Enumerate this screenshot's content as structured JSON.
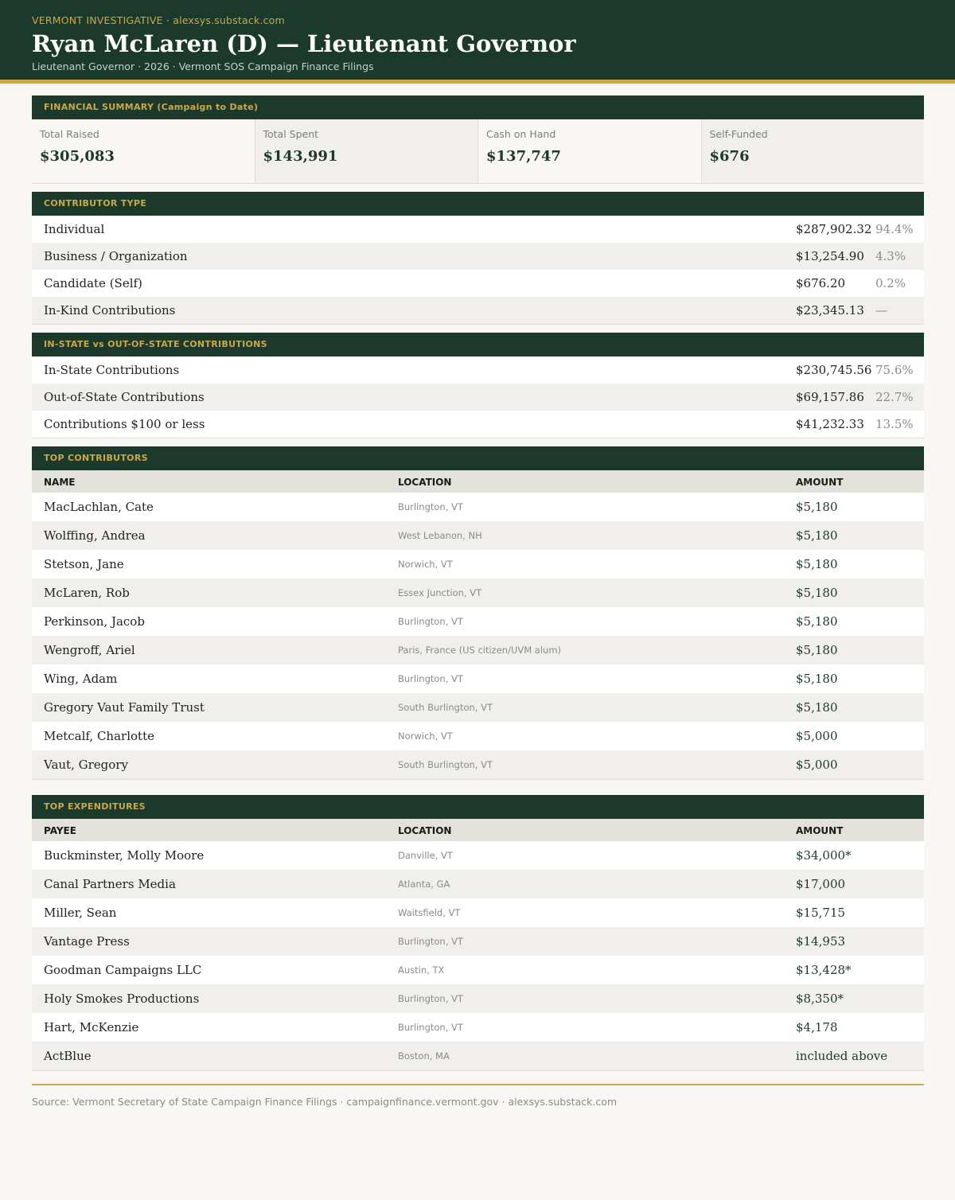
{
  "header": {
    "kicker": "VERMONT INVESTIGATIVE · alexsys.substack.com",
    "title": "Ryan McLaren (D) — Lieutenant Governor",
    "subtitle": "Lieutenant Governor · 2026 · Vermont SOS Campaign Finance Filings"
  },
  "summary": {
    "heading": "FINANCIAL SUMMARY (Campaign to Date)",
    "cells": [
      {
        "label": "Total Raised",
        "value": "$305,083"
      },
      {
        "label": "Total Spent",
        "value": "$143,991"
      },
      {
        "label": "Cash on Hand",
        "value": "$137,747"
      },
      {
        "label": "Self-Funded",
        "value": "$676"
      }
    ]
  },
  "contributor_type": {
    "heading": "CONTRIBUTOR TYPE",
    "rows": [
      {
        "label": "Individual",
        "amount": "$287,902.32",
        "pct": "94.4%"
      },
      {
        "label": "Business / Organization",
        "amount": "$13,254.90",
        "pct": "4.3%"
      },
      {
        "label": "Candidate (Self)",
        "amount": "$676.20",
        "pct": "0.2%"
      },
      {
        "label": "In-Kind Contributions",
        "amount": "$23,345.13",
        "pct": "—"
      }
    ]
  },
  "in_state": {
    "heading": "IN-STATE vs OUT-OF-STATE CONTRIBUTIONS",
    "rows": [
      {
        "label": "In-State Contributions",
        "amount": "$230,745.56",
        "pct": "75.6%"
      },
      {
        "label": "Out-of-State Contributions",
        "amount": "$69,157.86",
        "pct": "22.7%"
      },
      {
        "label": "Contributions $100 or less",
        "amount": "$41,232.33",
        "pct": "13.5%"
      }
    ]
  },
  "top_contributors": {
    "heading": "TOP CONTRIBUTORS",
    "columns": [
      "NAME",
      "LOCATION",
      "AMOUNT"
    ],
    "rows": [
      {
        "name": "MacLachlan, Cate",
        "location": "Burlington, VT",
        "amount": "$5,180"
      },
      {
        "name": "Wolffing, Andrea",
        "location": "West Lebanon, NH",
        "amount": "$5,180"
      },
      {
        "name": "Stetson, Jane",
        "location": "Norwich, VT",
        "amount": "$5,180"
      },
      {
        "name": "McLaren, Rob",
        "location": "Essex Junction, VT",
        "amount": "$5,180"
      },
      {
        "name": "Perkinson, Jacob",
        "location": "Burlington, VT",
        "amount": "$5,180"
      },
      {
        "name": "Wengroff, Ariel",
        "location": "Paris, France (US citizen/UVM alum)",
        "amount": "$5,180"
      },
      {
        "name": "Wing, Adam",
        "location": "Burlington, VT",
        "amount": "$5,180"
      },
      {
        "name": "Gregory Vaut Family Trust",
        "location": "South Burlington, VT",
        "amount": "$5,180"
      },
      {
        "name": "Metcalf, Charlotte",
        "location": "Norwich, VT",
        "amount": "$5,000"
      },
      {
        "name": "Vaut, Gregory",
        "location": "South Burlington, VT",
        "amount": "$5,000"
      }
    ]
  },
  "top_expenditures": {
    "heading": "TOP EXPENDITURES",
    "columns": [
      "PAYEE",
      "LOCATION",
      "AMOUNT"
    ],
    "rows": [
      {
        "name": "Buckminster, Molly Moore",
        "location": "Danville, VT",
        "amount": "$34,000*"
      },
      {
        "name": "Canal Partners Media",
        "location": "Atlanta, GA",
        "amount": "$17,000"
      },
      {
        "name": "Miller, Sean",
        "location": "Waitsfield, VT",
        "amount": "$15,715"
      },
      {
        "name": "Vantage Press",
        "location": "Burlington, VT",
        "amount": "$14,953"
      },
      {
        "name": "Goodman Campaigns LLC",
        "location": "Austin, TX",
        "amount": "$13,428*"
      },
      {
        "name": "Holy Smokes Productions",
        "location": "Burlington, VT",
        "amount": "$8,350*"
      },
      {
        "name": "Hart, McKenzie",
        "location": "Burlington, VT",
        "amount": "$4,178"
      },
      {
        "name": "ActBlue",
        "location": "Boston, MA",
        "amount": "included above"
      }
    ]
  },
  "footer": {
    "source": "Source: Vermont Secretary of State Campaign Finance Filings · campaignfinance.vermont.gov · alexsys.substack.com"
  }
}
